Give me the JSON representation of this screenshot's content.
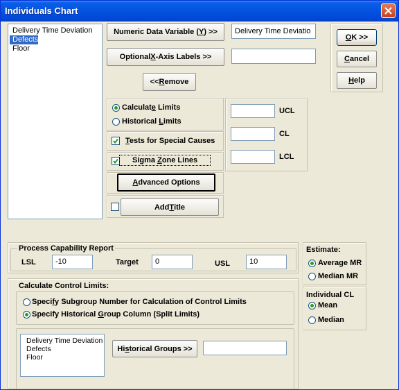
{
  "window": {
    "title": "Individuals Chart"
  },
  "variables": {
    "items": [
      "Delivery Time Deviation",
      "Defects",
      "Floor"
    ],
    "selected_index": 1
  },
  "buttons": {
    "numeric": {
      "pre": "Numeric Data Variable (",
      "ul": "Y",
      "post": ") >>"
    },
    "xaxis": {
      "pre": "Optional ",
      "ul": "X",
      "post": "-Axis Labels >>"
    },
    "remove": {
      "pre": "<< ",
      "ul": "R",
      "post": "emove"
    },
    "ok": {
      "pre": "",
      "ul": "O",
      "post": "K >>"
    },
    "cancel": {
      "pre": "",
      "ul": "C",
      "post": "ancel"
    },
    "help": {
      "pre": "",
      "ul": "H",
      "post": "elp"
    },
    "advanced": {
      "pre": "",
      "ul": "A",
      "post": "dvanced Options"
    },
    "add_title": {
      "pre": "Add ",
      "ul": "T",
      "post": "itle"
    },
    "historical_groups": {
      "pre": "Hi",
      "ul": "s",
      "post": "torical Groups >>"
    }
  },
  "fields": {
    "numeric_value": "Delivery Time Deviatio",
    "xaxis_value": "",
    "ucl": "",
    "cl": "",
    "lcl": "",
    "historical_value": ""
  },
  "limits": {
    "calculate": {
      "pre": "Calculat",
      "ul": "e",
      "post": " Limits",
      "checked": true
    },
    "historical": {
      "pre": "Historical ",
      "ul": "L",
      "post": "imits",
      "checked": false
    }
  },
  "tests": {
    "pre": "",
    "ul": "T",
    "post": "ests for Special Causes",
    "checked": true
  },
  "sigma": {
    "pre": "Sigma ",
    "ul": "Z",
    "post": "one Lines",
    "checked": true
  },
  "add_title_checked": false,
  "labels": {
    "ucl": "UCL",
    "cl": "CL",
    "lcl": "LCL"
  },
  "capability": {
    "title": "Process Capability Report",
    "lsl_label": "LSL",
    "lsl_value": "-10",
    "target_label": "Target",
    "target_value": "0",
    "usl_label": "USL",
    "usl_value": "10"
  },
  "estimate": {
    "title": "Estimate:",
    "options": [
      {
        "label": "Average MR",
        "checked": true
      },
      {
        "label": "Median MR",
        "checked": false
      }
    ]
  },
  "individual_cl": {
    "title": "Individual CL",
    "options": [
      {
        "label": "Mean",
        "checked": true
      },
      {
        "label": "Median",
        "checked": false
      }
    ]
  },
  "control_limits": {
    "title": "Calculate Control Limits:",
    "subgroup": {
      "pre": "Speci",
      "ul": "f",
      "post": "y Subgroup Number for Calculation of Control Limits",
      "checked": false
    },
    "historical": {
      "pre": "Specify Historical ",
      "ul": "G",
      "post": "roup Column (Split Limits)",
      "checked": true
    },
    "list": [
      "Delivery Time Deviation",
      "Defects",
      "Floor"
    ]
  },
  "colors": {
    "title_bar": "#0553e0",
    "dialog_bg": "#ece9d8",
    "selection": "#316ac5",
    "radio_dot": "#21a121"
  },
  "icons": {
    "close": "close-icon",
    "check": "checkmark-icon",
    "radio": "radio-dot-icon"
  }
}
